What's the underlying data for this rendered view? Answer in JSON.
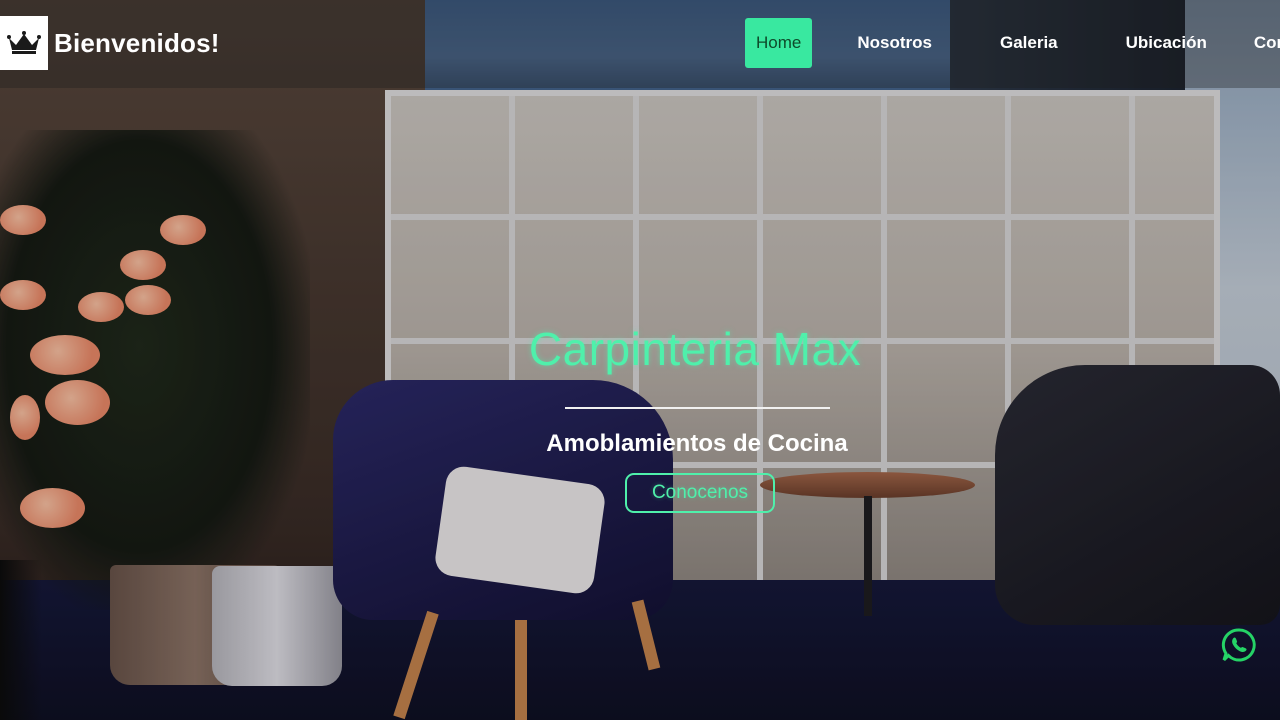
{
  "brand": {
    "title": "Bienvenidos!",
    "logo_icon": "crown-icon"
  },
  "nav": {
    "items": [
      {
        "label": "Home",
        "active": true
      },
      {
        "label": "Nosotros",
        "active": false
      },
      {
        "label": "Galeria",
        "active": false
      },
      {
        "label": "Ubicación",
        "active": false
      },
      {
        "label": "Contacto",
        "active": false
      }
    ]
  },
  "hero": {
    "title": "Carpinteria Max",
    "subtitle": "Amoblamientos de Cocina",
    "cta_label": "Conocenos"
  },
  "floating": {
    "whatsapp_icon": "whatsapp-icon"
  },
  "colors": {
    "accent": "#39e8a0",
    "title_green": "#4ff0ab",
    "whatsapp_green": "#25d366"
  }
}
